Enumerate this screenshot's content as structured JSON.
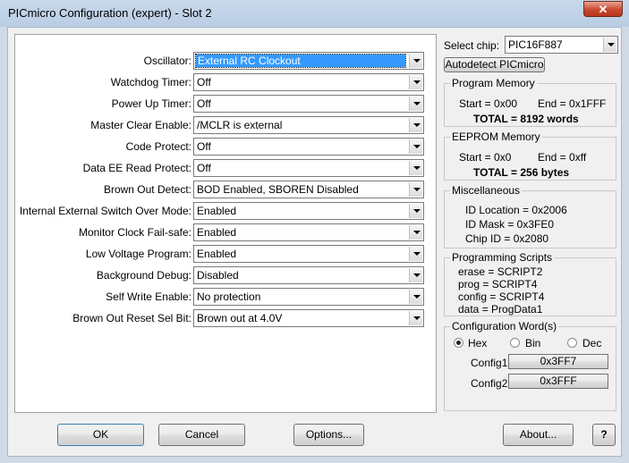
{
  "window": {
    "title": "PICmicro Configuration (expert) - Slot 2",
    "close_label": "✕"
  },
  "config_rows": [
    {
      "label": "Oscillator:",
      "value": "External RC Clockout"
    },
    {
      "label": "Watchdog Timer:",
      "value": "Off"
    },
    {
      "label": "Power Up Timer:",
      "value": "Off"
    },
    {
      "label": "Master Clear Enable:",
      "value": "/MCLR is external"
    },
    {
      "label": "Code Protect:",
      "value": "Off"
    },
    {
      "label": "Data EE Read Protect:",
      "value": "Off"
    },
    {
      "label": "Brown Out Detect:",
      "value": "BOD Enabled, SBOREN Disabled"
    },
    {
      "label": "Internal External Switch Over Mode:",
      "value": "Enabled"
    },
    {
      "label": "Monitor Clock Fail-safe:",
      "value": "Enabled"
    },
    {
      "label": "Low Voltage Program:",
      "value": "Enabled"
    },
    {
      "label": "Background Debug:",
      "value": "Disabled"
    },
    {
      "label": "Self Write Enable:",
      "value": "No protection"
    },
    {
      "label": "Brown Out Reset Sel Bit:",
      "value": "Brown out at 4.0V"
    }
  ],
  "chip": {
    "label": "Select chip:",
    "value": "PIC16F887",
    "autodetect_label": "Autodetect PICmicro"
  },
  "program_memory": {
    "title": "Program Memory",
    "start": "Start = 0x00",
    "end": "End = 0x1FFF",
    "total": "TOTAL = 8192 words"
  },
  "eeprom_memory": {
    "title": "EEPROM Memory",
    "start": "Start = 0x0",
    "end": "End = 0xff",
    "total": "TOTAL = 256 bytes"
  },
  "misc": {
    "title": "Miscellaneous",
    "id_location": "ID Location = 0x2006",
    "id_mask": "ID Mask = 0x3FE0",
    "chip_id": "Chip ID = 0x2080"
  },
  "scripts": {
    "title": "Programming Scripts",
    "erase": "erase = SCRIPT2",
    "prog": "prog = SCRIPT4",
    "config": "config = SCRIPT4",
    "data": "data = ProgData1"
  },
  "config_words": {
    "title": "Configuration Word(s)",
    "radio_hex": "Hex",
    "radio_bin": "Bin",
    "radio_dec": "Dec",
    "selected": "Hex",
    "config1_label": "Config1",
    "config1_value": "0x3FF7",
    "config2_label": "Config2",
    "config2_value": "0x3FFF"
  },
  "buttons": {
    "ok": "OK",
    "cancel": "Cancel",
    "options": "Options...",
    "about": "About...",
    "help": "?"
  }
}
